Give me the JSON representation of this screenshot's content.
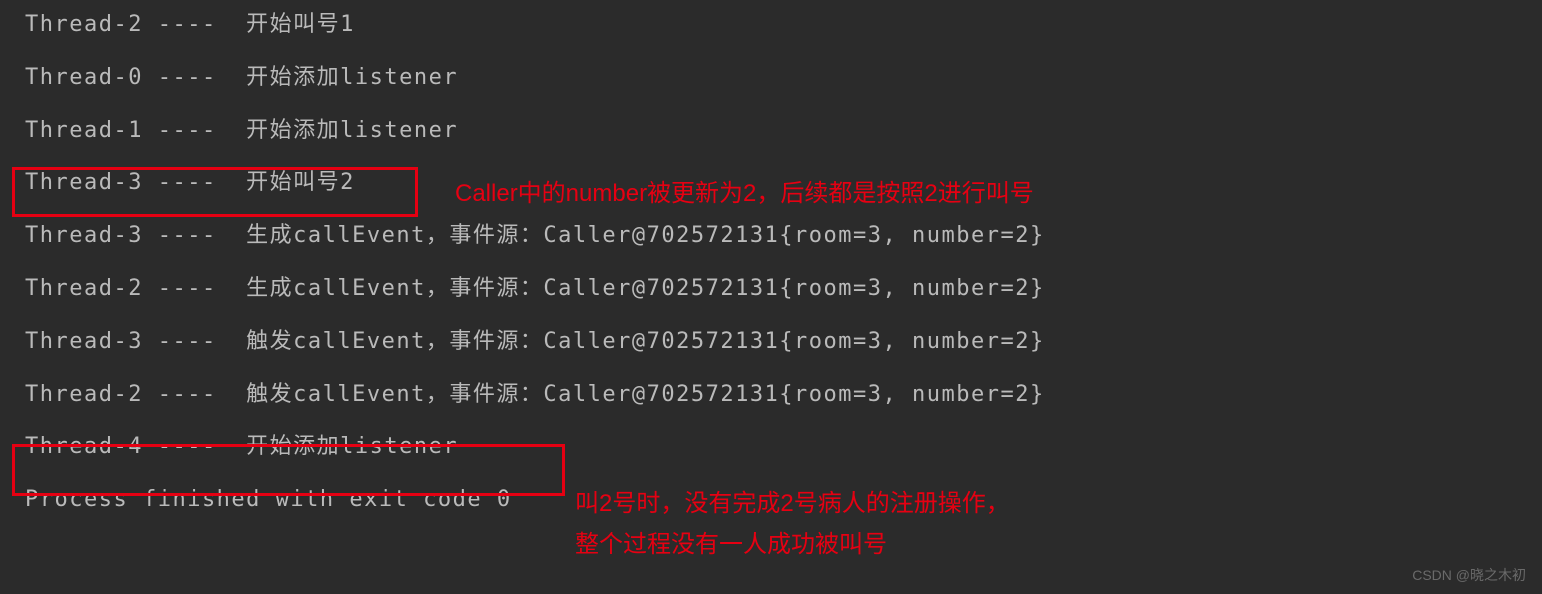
{
  "console": {
    "lines": [
      "Thread-2 ----  开始叫号1",
      "Thread-0 ----  开始添加listener",
      "Thread-1 ----  开始添加listener",
      "Thread-3 ----  开始叫号2",
      "Thread-3 ----  生成callEvent，事件源：Caller@702572131{room=3, number=2}",
      "Thread-2 ----  生成callEvent，事件源：Caller@702572131{room=3, number=2}",
      "Thread-3 ----  触发callEvent，事件源：Caller@702572131{room=3, number=2}",
      "Thread-2 ----  触发callEvent，事件源：Caller@702572131{room=3, number=2}",
      "Thread-4 ----  开始添加listener",
      "",
      "Process finished with exit code 0"
    ]
  },
  "annotations": {
    "note1": "Caller中的number被更新为2，后续都是按照2进行叫号",
    "note2": "叫2号时，没有完成2号病人的注册操作，",
    "note3": "整个过程没有一人成功被叫号"
  },
  "watermark": "CSDN @晓之木初"
}
